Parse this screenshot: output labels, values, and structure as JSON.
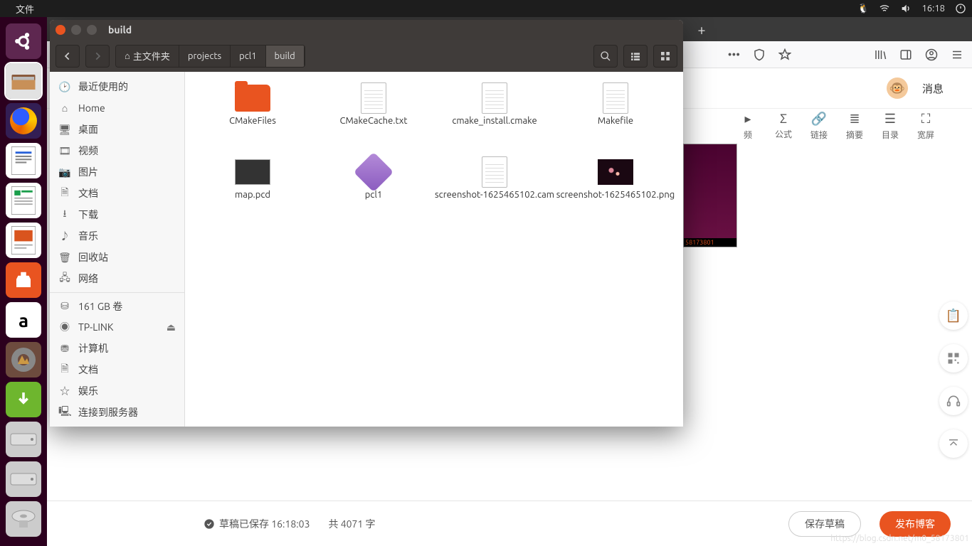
{
  "menubar": {
    "app": "文件",
    "time": "16:18"
  },
  "nautilus": {
    "title": "build",
    "path": {
      "home": "主文件夹",
      "segs": [
        "projects",
        "pcl1",
        "build"
      ]
    },
    "places": [
      {
        "icon": "clock",
        "label": "最近使用的"
      },
      {
        "icon": "home",
        "label": "Home"
      },
      {
        "icon": "desktop",
        "label": "桌面"
      },
      {
        "icon": "video",
        "label": "视频"
      },
      {
        "icon": "camera",
        "label": "图片"
      },
      {
        "icon": "doc",
        "label": "文档"
      },
      {
        "icon": "download",
        "label": "下载"
      },
      {
        "icon": "music",
        "label": "音乐"
      },
      {
        "icon": "trash",
        "label": "回收站"
      },
      {
        "icon": "network",
        "label": "网络"
      }
    ],
    "devices": [
      {
        "icon": "disk",
        "label": "161 GB 卷"
      },
      {
        "icon": "disc",
        "label": "TP-LINK",
        "eject": true
      },
      {
        "icon": "computer",
        "label": "计算机"
      },
      {
        "icon": "doc",
        "label": "文档"
      },
      {
        "icon": "star",
        "label": "娱乐"
      },
      {
        "icon": "server",
        "label": "连接到服务器"
      }
    ],
    "files": [
      {
        "icon": "folder",
        "name": "CMakeFiles"
      },
      {
        "icon": "text",
        "name": "CMakeCache.txt"
      },
      {
        "icon": "text",
        "name": "cmake_install.cmake"
      },
      {
        "icon": "text",
        "name": "Makefile"
      },
      {
        "icon": "img",
        "name": "map.pcd"
      },
      {
        "icon": "exe",
        "name": "pcl1"
      },
      {
        "icon": "text",
        "name": "screenshot-1625465102.cam"
      },
      {
        "icon": "png",
        "name": "screenshot-1625465102.png"
      }
    ]
  },
  "browser": {
    "msg": "消息",
    "tools": [
      {
        "ic": "Σ",
        "label": "公式"
      },
      {
        "ic": "🔗",
        "label": "链接"
      },
      {
        "ic": "≣",
        "label": "摘要"
      },
      {
        "ic": "☰",
        "label": "目录"
      },
      {
        "ic": "⛶",
        "label": "宽屏"
      }
    ],
    "thumb_badge": "58173801",
    "footer": {
      "status": "草稿已保存 16:18:03",
      "words": "共 4071 字",
      "save": "保存草稿",
      "publish": "发布博客"
    },
    "watermark": "https://blog.csdn.net/m0_58173801"
  }
}
